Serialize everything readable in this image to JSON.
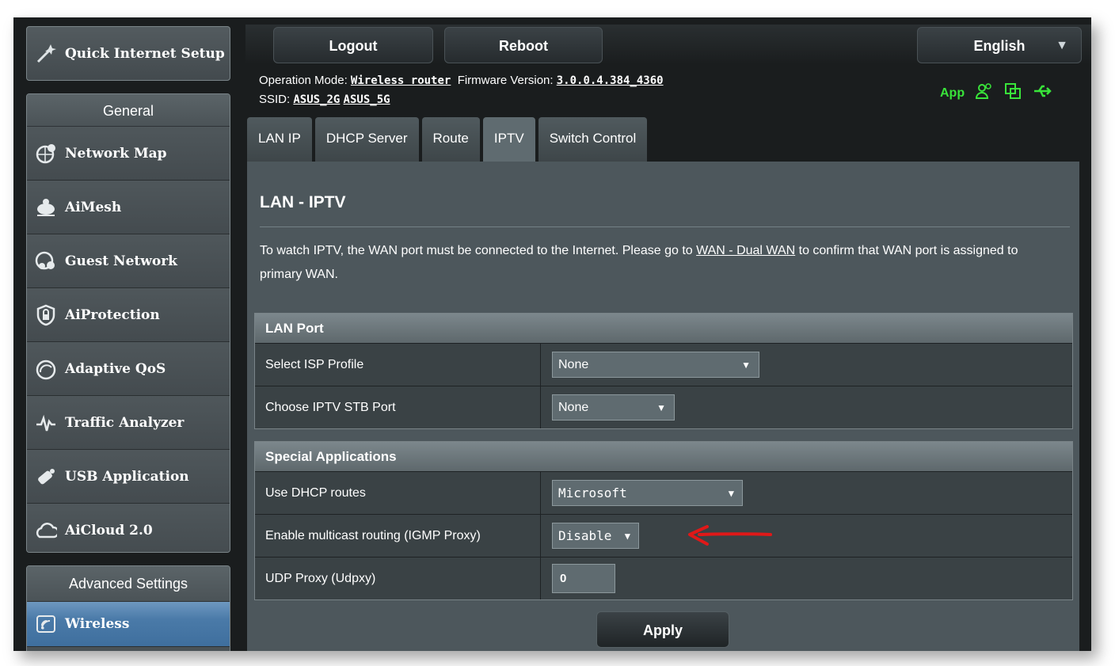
{
  "sidebar": {
    "quick_setup": "Quick Internet Setup",
    "general_header": "General",
    "general_items": [
      {
        "label": "Network Map",
        "icon": "network-map-icon"
      },
      {
        "label": "AiMesh",
        "icon": "aimesh-icon"
      },
      {
        "label": "Guest Network",
        "icon": "guest-network-icon"
      },
      {
        "label": "AiProtection",
        "icon": "shield-lock-icon"
      },
      {
        "label": "Adaptive QoS",
        "icon": "gauge-icon"
      },
      {
        "label": "Traffic Analyzer",
        "icon": "traffic-waveform-icon"
      },
      {
        "label": "USB Application",
        "icon": "usb-icon"
      },
      {
        "label": "AiCloud 2.0",
        "icon": "cloud-icon"
      }
    ],
    "advanced_header": "Advanced Settings",
    "advanced_items": [
      {
        "label": "Wireless",
        "icon": "wireless-icon"
      }
    ]
  },
  "topbar": {
    "logout": "Logout",
    "reboot": "Reboot",
    "language": "English"
  },
  "info": {
    "op_mode_label": "Operation Mode:",
    "op_mode_value": "Wireless router",
    "firmware_label": "Firmware Version:",
    "firmware_value": "3.0.0.4.384_4360",
    "ssid_label": "SSID:",
    "ssid_2g": "ASUS_2G",
    "ssid_5g": "ASUS_5G",
    "app_label": "App"
  },
  "tabs": [
    "LAN IP",
    "DHCP Server",
    "Route",
    "IPTV",
    "Switch Control"
  ],
  "active_tab": "IPTV",
  "page": {
    "title": "LAN - IPTV",
    "desc_part1": "To watch IPTV, the WAN port must be connected to the Internet. Please go to ",
    "desc_link": "WAN - Dual WAN",
    "desc_part2": " to confirm that WAN port is assigned to primary WAN."
  },
  "lan_port": {
    "header": "LAN Port",
    "isp_profile_label": "Select ISP Profile",
    "isp_profile_value": "None",
    "stb_port_label": "Choose IPTV STB Port",
    "stb_port_value": "None"
  },
  "special_apps": {
    "header": "Special Applications",
    "dhcp_routes_label": "Use DHCP routes",
    "dhcp_routes_value": "Microsoft",
    "igmp_label": "Enable multicast routing (IGMP Proxy)",
    "igmp_value": "Disable",
    "udpxy_label": "UDP Proxy (Udpxy)",
    "udpxy_value": "0"
  },
  "apply": "Apply",
  "colors": {
    "accent_green": "#39e43a",
    "annotation_red": "#e01818"
  }
}
